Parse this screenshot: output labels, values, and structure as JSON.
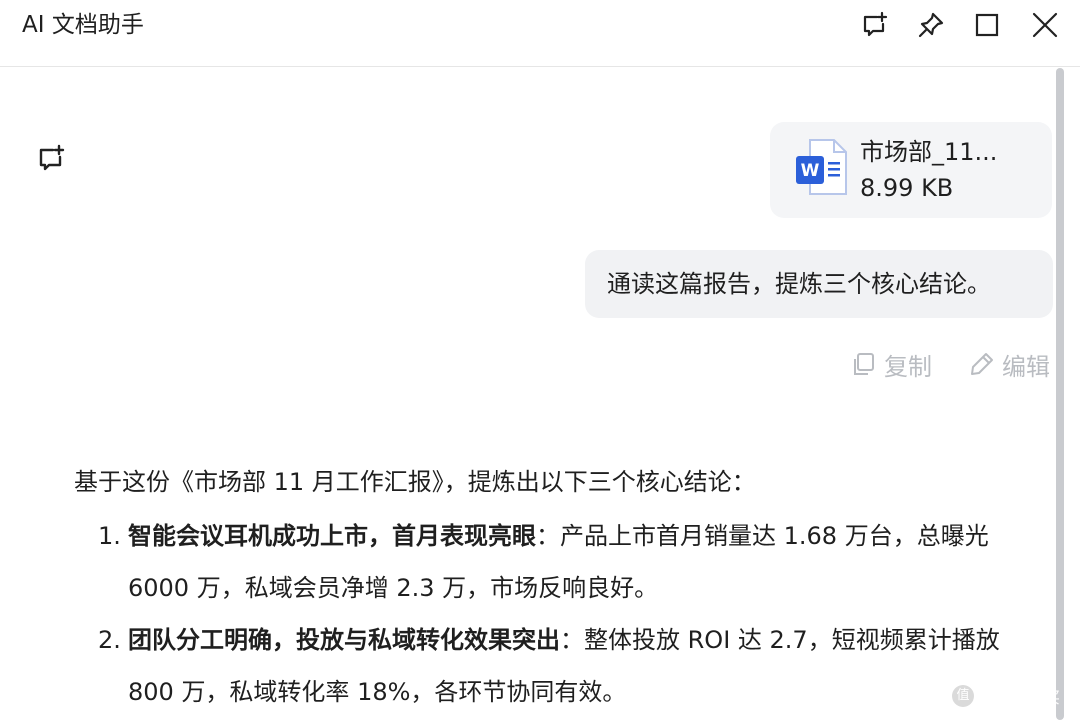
{
  "window": {
    "title": "AI 文档助手"
  },
  "titlebar_icons": [
    "new-chat-icon",
    "pin-icon",
    "maximize-icon",
    "close-icon"
  ],
  "attachment": {
    "name": "市场部_11...",
    "size": "8.99 KB",
    "icon": "word-doc-icon",
    "color": "#2b5fd9"
  },
  "user_message": {
    "text": "通读这篇报告，提炼三个核心结论。"
  },
  "message_actions": {
    "copy_label": "复制",
    "edit_label": "编辑"
  },
  "answer": {
    "intro": "基于这份《市场部 11 月工作汇报》，提炼出以下三个核心结论：",
    "items": [
      {
        "number": "1.",
        "heading": "智能会议耳机成功上市，首月表现亮眼",
        "body": "：产品上市首月销量达 1.68 万台，总曝光 6000 万，私域会员净增 2.3 万，市场反响良好。"
      },
      {
        "number": "2.",
        "heading": "团队分工明确，投放与私域转化效果突出",
        "body": "：整体投放 ROI 达 2.7，短视频累计播放 800 万，私域转化率 18%，各环节协同有效。"
      }
    ]
  },
  "watermark": {
    "text": "什么值得买",
    "badge": "值"
  }
}
